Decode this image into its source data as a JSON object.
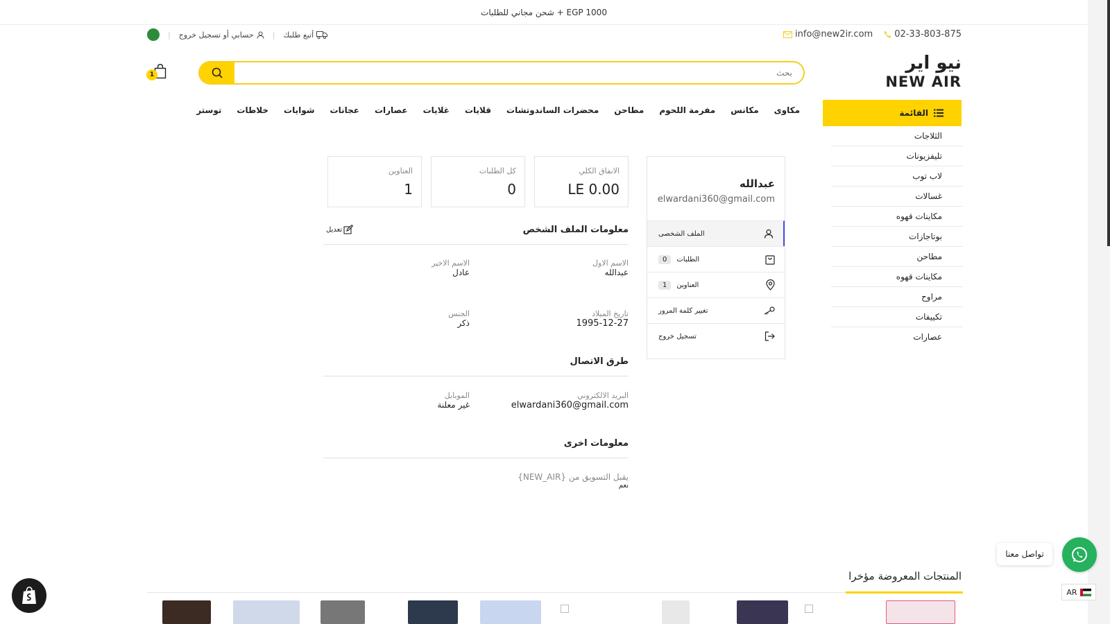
{
  "announcement": "شحن مجاني للطلبات + EGP 1000",
  "contact": {
    "phone": "02-33-803-875",
    "email": "info@new2ir.com"
  },
  "utility": {
    "track_order": "أتبع طلبك",
    "account": "حسابي أو تسجيل خروج"
  },
  "logo": {
    "arabic": "نيو اير",
    "english": "NEW AIR"
  },
  "search": {
    "placeholder": "بحث"
  },
  "cart": {
    "count": "1"
  },
  "categories_button": "القائمة",
  "nav": [
    "مكاوى",
    "مكانس",
    "مفرمة اللحوم",
    "مطاحن",
    "محضرات الساندوتشات",
    "قلايات",
    "غلايات",
    "عصارات",
    "عجانات",
    "شوايات",
    "خلاطات",
    "توستر"
  ],
  "side_categories": [
    "الثلاجات",
    "تليفزيونات",
    "لاب توب",
    "غسالات",
    "مكاينات قهوه",
    "بوتاجازات",
    "مطاحن",
    "مكاينات قهوه",
    "مراوح",
    "تكييفات",
    "عصارات"
  ],
  "stats": {
    "total_spend": {
      "label": "الانفاق الكلي",
      "value": "LE 0.00"
    },
    "all_orders": {
      "label": "كل الطلبات",
      "value": "0"
    },
    "addresses": {
      "label": "العناوين",
      "value": "1"
    }
  },
  "profile": {
    "name": "عبدالله",
    "email": "elwardani360@gmail.com",
    "menu": [
      {
        "label": "الملف الشخصى",
        "count": ""
      },
      {
        "label": "الطلبات",
        "count": "0"
      },
      {
        "label": "العناوين",
        "count": "1"
      },
      {
        "label": "تغيير كلمة المرور",
        "count": ""
      },
      {
        "label": "تسجيل خروج",
        "count": ""
      }
    ]
  },
  "personal_info": {
    "title": "معلومات الملف الشخص",
    "edit": "تعديل",
    "first_name_label": "الاسم الاول",
    "first_name": "عبدالله",
    "last_name_label": "الاسم الاخير",
    "last_name": "عادل",
    "birthdate_label": "تاريخ الميلاد",
    "birthdate": "1995-12-27",
    "gender_label": "الجنس",
    "gender": "ذكر"
  },
  "contact_methods": {
    "title": "طرق الاتصال",
    "email_label": "البريد الالكتروني",
    "email": "elwardani360@gmail.com",
    "mobile_label": "الموبايل",
    "mobile": "غير معلنة"
  },
  "other_info": {
    "title": "معلومات اخرى",
    "marketing_label": "يقبل التسويق من {NEW_AIR}",
    "marketing_value": "نعم"
  },
  "whatsapp": {
    "label": "تواصل معنا"
  },
  "language": "AR",
  "recently_viewed": "المنتجات المعروضة مؤخرا",
  "colors": {
    "accent": "#ffd200",
    "whatsapp": "#26b15f",
    "active": "#4a4af0"
  }
}
